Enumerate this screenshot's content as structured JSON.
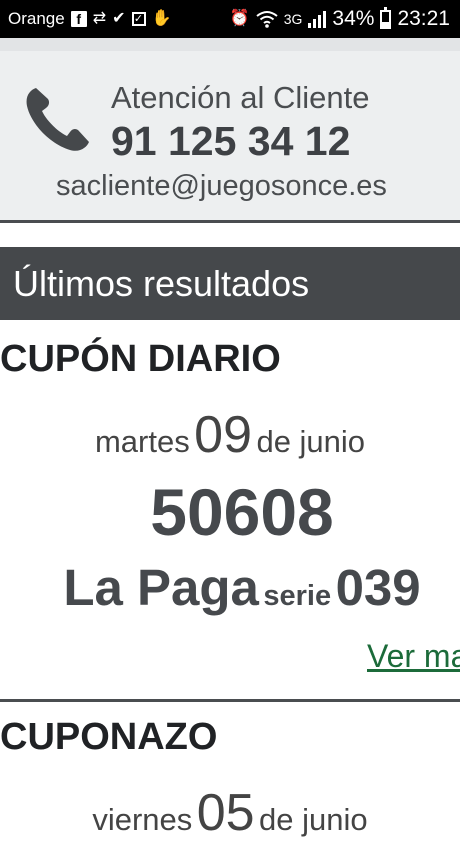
{
  "status_bar": {
    "carrier": "Orange",
    "network": "3G",
    "battery": "34%",
    "time": "23:21",
    "icons": [
      "facebook-icon",
      "retweet-icon",
      "check-icon",
      "checkbox-icon",
      "hand-icon",
      "alarm-icon",
      "wifi-icon",
      "signal-icon",
      "battery-icon"
    ]
  },
  "contact": {
    "title": "Atención al Cliente",
    "phone": "91 125 34 12",
    "email": "sacliente@juegosonce.es"
  },
  "results": {
    "header": "Últimos resultados",
    "draws": [
      {
        "game": "CUPÓN DIARIO",
        "weekday": "martes",
        "day": "09",
        "month_prefix": "de junio",
        "number": "50608",
        "prize_name": "La Paga",
        "serie_label": "serie",
        "serie": "039",
        "more_link": "Ver ma"
      },
      {
        "game": "CUPONAZO",
        "weekday": "viernes",
        "day": "05",
        "month_prefix": "de junio"
      }
    ]
  },
  "colors": {
    "status_bar": "#000000",
    "contact_bg": "#edeff0",
    "header_bg": "#45484b",
    "link": "#1c6b3a"
  }
}
